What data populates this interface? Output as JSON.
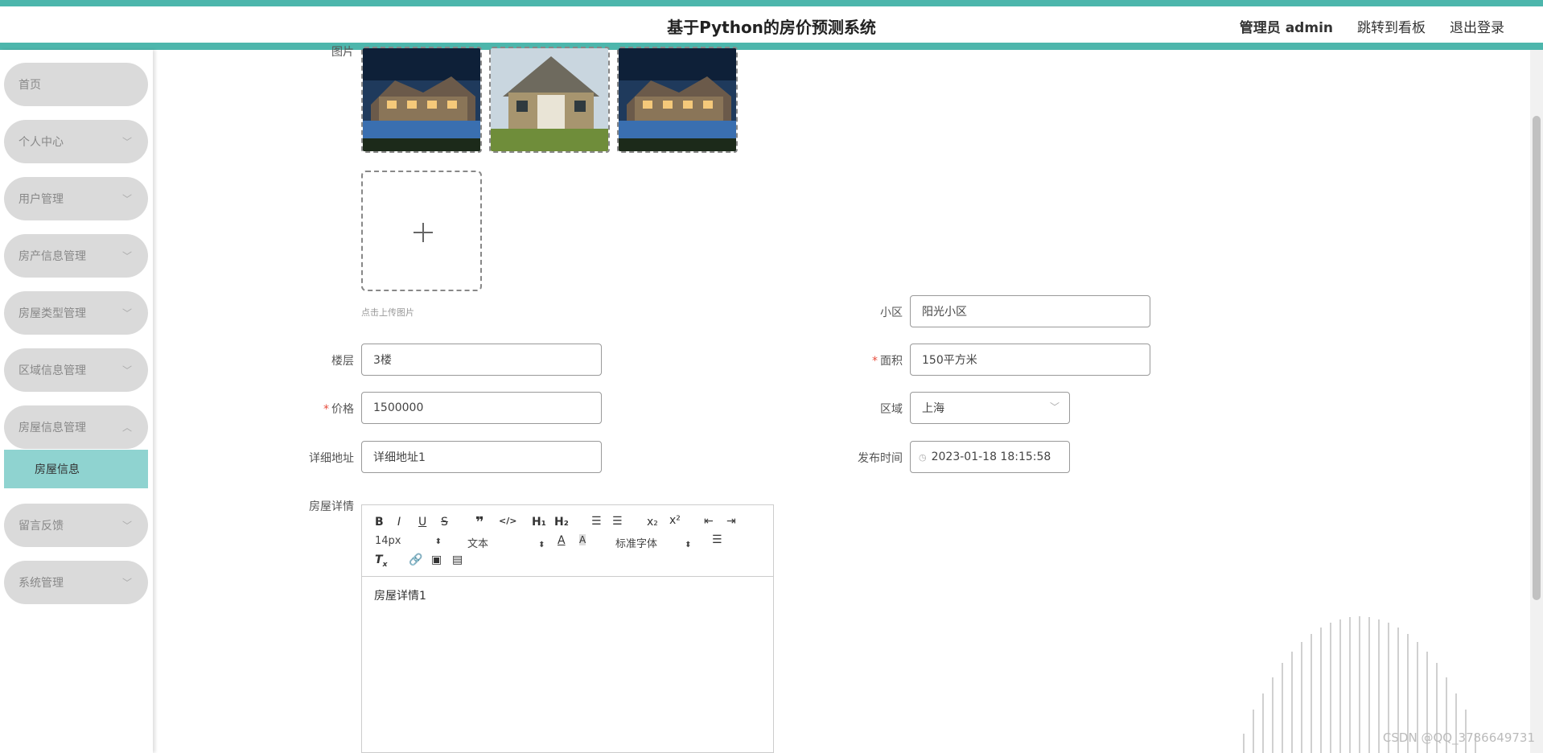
{
  "header": {
    "title": "基于Python的房价预测系统",
    "user": "管理员 admin",
    "dashboard_link": "跳转到看板",
    "logout_link": "退出登录"
  },
  "sidebar": {
    "items": [
      {
        "label": "首页"
      },
      {
        "label": "个人中心"
      },
      {
        "label": "用户管理"
      },
      {
        "label": "房产信息管理"
      },
      {
        "label": "房屋类型管理"
      },
      {
        "label": "区域信息管理"
      },
      {
        "label": "房屋信息管理"
      },
      {
        "label": "留言反馈"
      },
      {
        "label": "系统管理"
      }
    ],
    "active_sub": "房屋信息"
  },
  "form": {
    "image_label": "图片",
    "upload_hint": "点击上传图片",
    "community_label": "小区",
    "community_value": "阳光小区",
    "floor_label": "楼层",
    "floor_value": "3楼",
    "area_label": "面积",
    "area_value": "150平方米",
    "price_label": "价格",
    "price_value": "1500000",
    "region_label": "区域",
    "region_value": "上海",
    "address_label": "详细地址",
    "address_value": "详细地址1",
    "publish_label": "发布时间",
    "publish_value": "2023-01-18 18:15:58",
    "details_label": "房屋详情"
  },
  "editor": {
    "font_size": "14px",
    "block_type": "文本",
    "font_family": "标准字体",
    "content": "房屋详情1"
  },
  "watermark": "CSDN @QQ_3786649731"
}
